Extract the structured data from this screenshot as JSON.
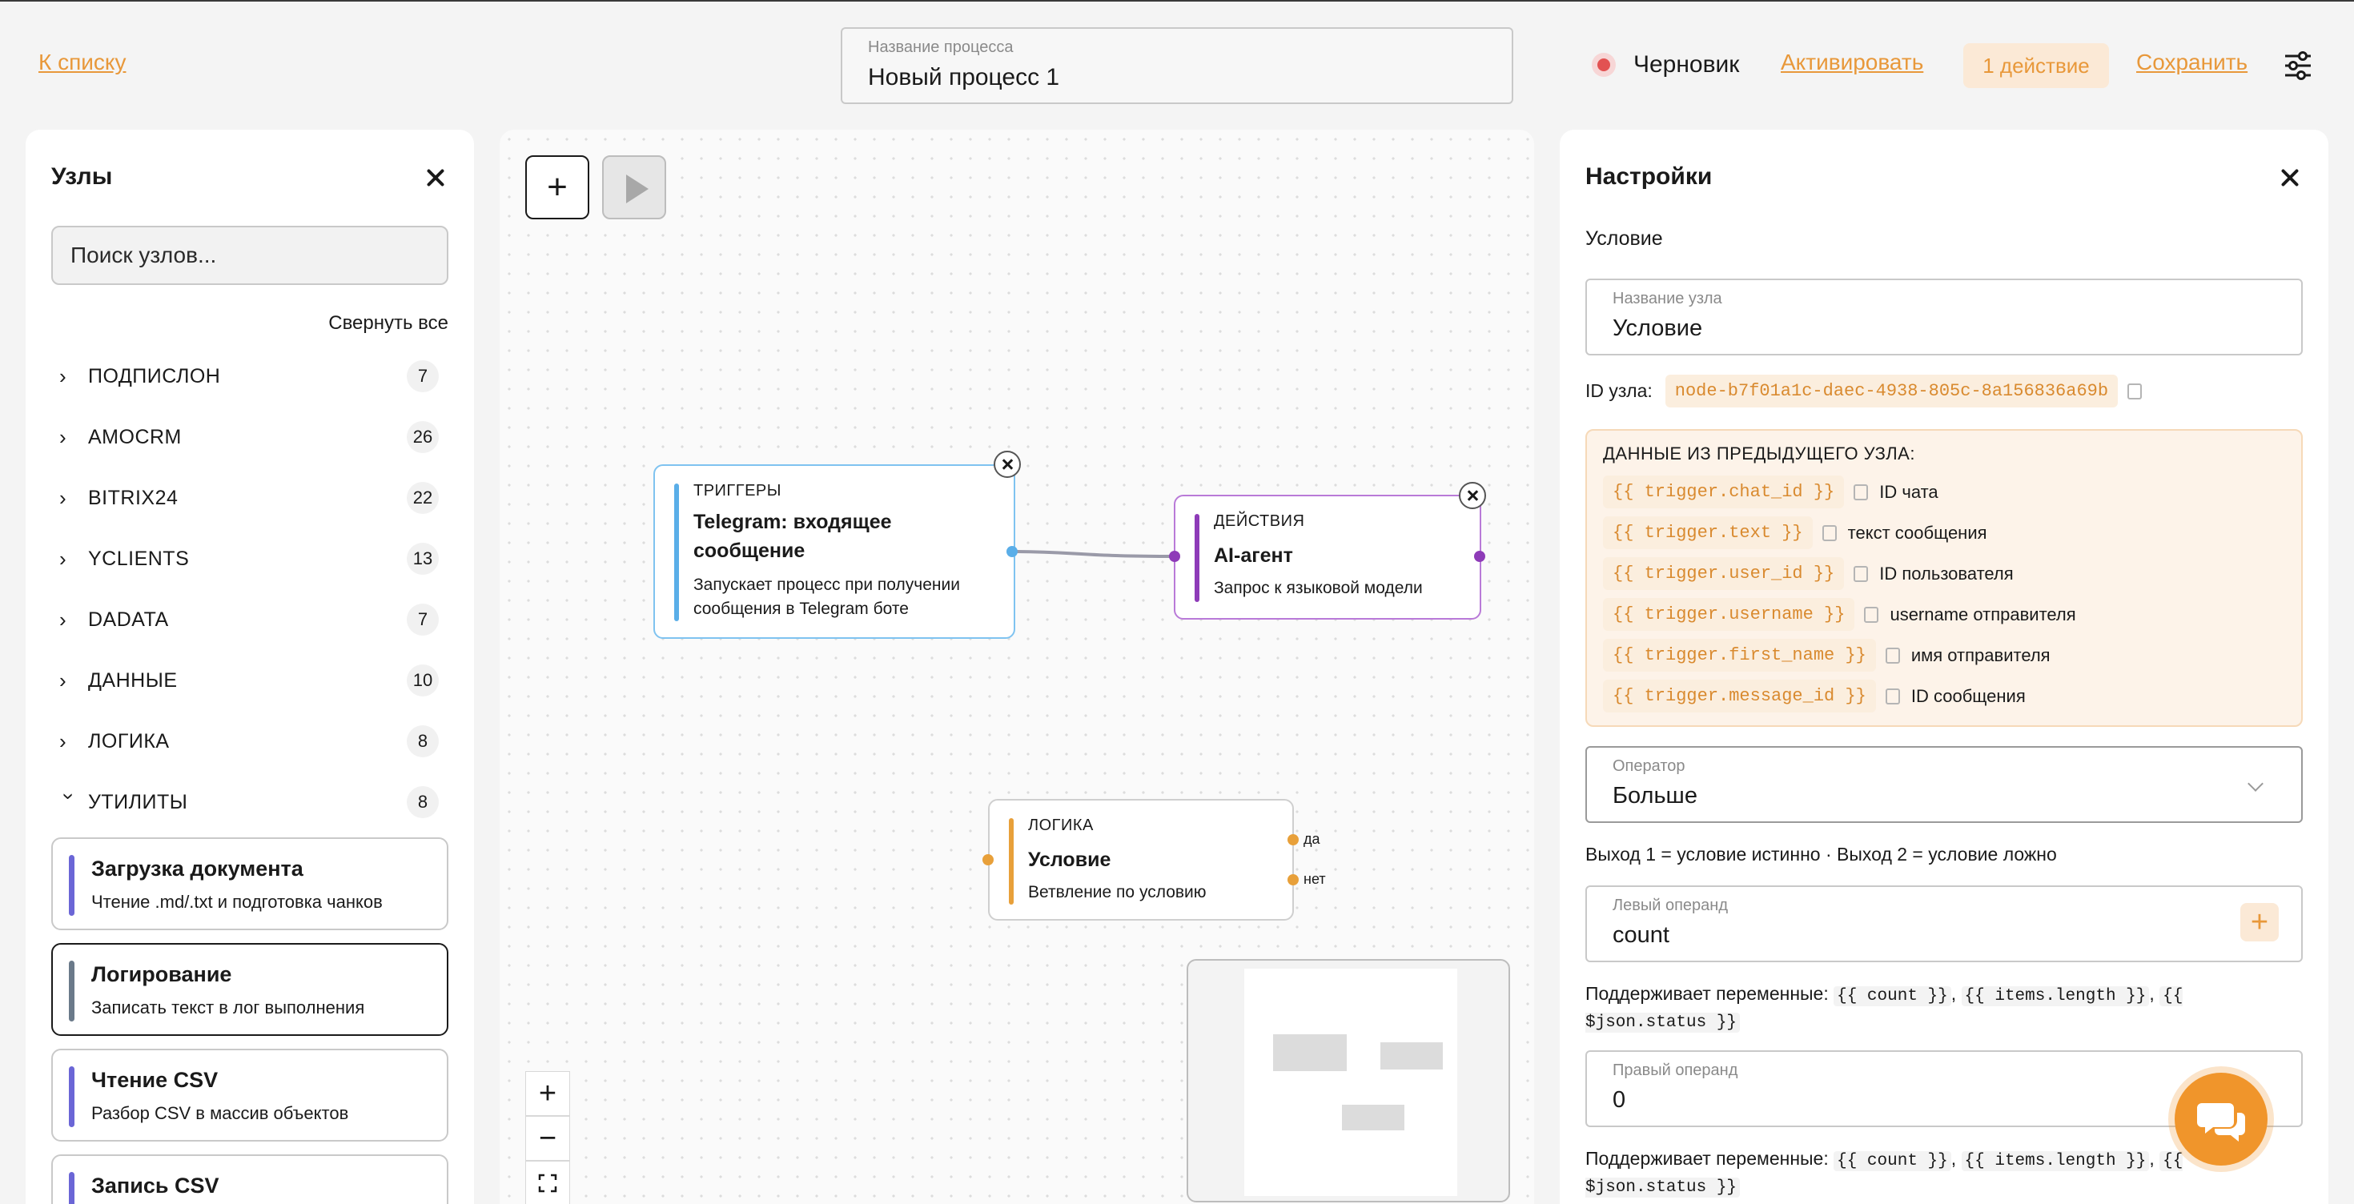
{
  "header": {
    "back_link": "К списку",
    "process_name_label": "Название процесса",
    "process_name": "Новый процесс 1",
    "status": "Черновик",
    "activate": "Активировать",
    "actions_badge": "1 действие",
    "save": "Сохранить"
  },
  "nodes_panel": {
    "title": "Узлы",
    "search_placeholder": "Поиск узлов...",
    "collapse_all": "Свернуть все",
    "categories": [
      {
        "name": "ПОДПИСЛОН",
        "count": "7",
        "expanded": false
      },
      {
        "name": "AMOCRM",
        "count": "26",
        "expanded": false
      },
      {
        "name": "BITRIX24",
        "count": "22",
        "expanded": false
      },
      {
        "name": "YCLIENTS",
        "count": "13",
        "expanded": false
      },
      {
        "name": "DADATA",
        "count": "7",
        "expanded": false
      },
      {
        "name": "ДАННЫЕ",
        "count": "10",
        "expanded": false
      },
      {
        "name": "ЛОГИКА",
        "count": "8",
        "expanded": false
      },
      {
        "name": "УТИЛИТЫ",
        "count": "8",
        "expanded": true
      }
    ],
    "utilities": [
      {
        "title": "Загрузка документа",
        "desc": "Чтение .md/.txt и подготовка чанков",
        "color": "#6b66d6"
      },
      {
        "title": "Логирование",
        "desc": "Записать текст в лог выполнения",
        "color": "#6b7a8a"
      },
      {
        "title": "Чтение CSV",
        "desc": "Разбор CSV в массив объектов",
        "color": "#6b66d6"
      },
      {
        "title": "Запись CSV",
        "desc": "",
        "color": "#6b66d6"
      }
    ]
  },
  "canvas": {
    "nodes": [
      {
        "category": "ТРИГГЕРЫ",
        "title_line1": "Telegram: входящее",
        "title_line2": "сообщение",
        "desc_line1": "Запускает процесс при получении",
        "desc_line2": "сообщения в Telegram боте",
        "color": "#5aaee8"
      },
      {
        "category": "ДЕЙСТВИЯ",
        "title": "AI-агент",
        "desc": "Запрос к языковой модели",
        "color": "#8e3bb8"
      },
      {
        "category": "ЛОГИКА",
        "title": "Условие",
        "desc": "Ветвление по условию",
        "color": "#e8a03a",
        "out_true": "да",
        "out_false": "нет"
      }
    ]
  },
  "settings": {
    "title": "Настройки",
    "node_type": "Условие",
    "node_name_label": "Название узла",
    "node_name": "Условие",
    "node_id_label": "ID узла:",
    "node_id": "node-b7f01a1c-daec-4938-805c-8a156836a69b",
    "prev_data_title": "ДАННЫЕ ИЗ ПРЕДЫДУЩЕГО УЗЛА:",
    "variables": [
      {
        "code": "{{ trigger.chat_id }}",
        "desc": "ID чата"
      },
      {
        "code": "{{ trigger.text }}",
        "desc": "текст сообщения"
      },
      {
        "code": "{{ trigger.user_id }}",
        "desc": "ID пользователя"
      },
      {
        "code": "{{ trigger.username }}",
        "desc": "username отправителя"
      },
      {
        "code": "{{ trigger.first_name }}",
        "desc": "имя отправителя"
      },
      {
        "code": "{{ trigger.message_id }}",
        "desc": "ID сообщения"
      }
    ],
    "operator_label": "Оператор",
    "operator": "Больше",
    "outputs_hint": "Выход 1 = условие истинно · Выход 2 = условие ложно",
    "left_label": "Левый операнд",
    "left_value": "count",
    "supports_text": "Поддерживает переменные:",
    "supports_codes": [
      "{{ count }}",
      "{{ items.length }}",
      "{{ $json.status }}"
    ],
    "right_label": "Правый операнд",
    "right_value": "0"
  }
}
